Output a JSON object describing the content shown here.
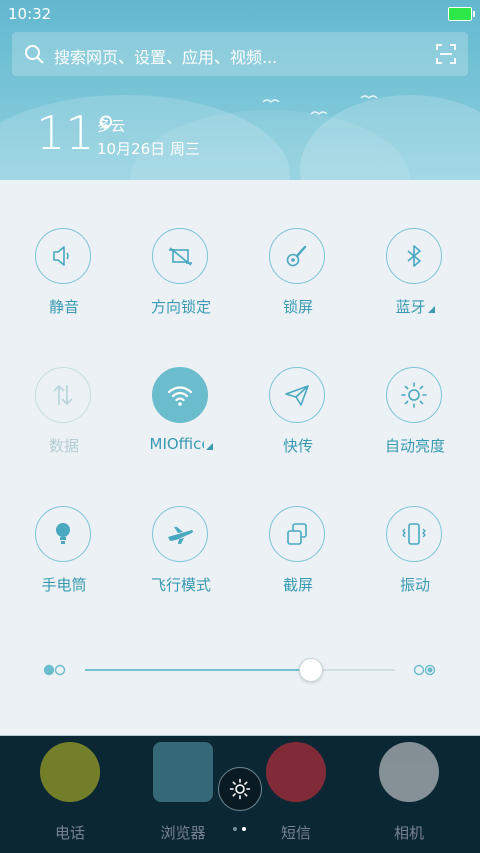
{
  "status": {
    "time": "10:32"
  },
  "search": {
    "placeholder": "搜索网页、设置、应用、视频..."
  },
  "weather": {
    "temperature": "11°",
    "condition": "多云",
    "date": "10月26日 周三"
  },
  "toggles": [
    {
      "label": "静音",
      "icon": "speaker-icon",
      "state": "off"
    },
    {
      "label": "方向锁定",
      "icon": "rotation-lock-icon",
      "state": "off"
    },
    {
      "label": "锁屏",
      "icon": "lock-screen-icon",
      "state": "off"
    },
    {
      "label": "蓝牙",
      "icon": "bluetooth-icon",
      "state": "off",
      "has_menu": true
    },
    {
      "label": "数据",
      "icon": "mobile-data-icon",
      "state": "disabled"
    },
    {
      "label": "MIOffice",
      "icon": "wifi-icon",
      "state": "on",
      "has_menu": true
    },
    {
      "label": "快传",
      "icon": "paper-plane-icon",
      "state": "off"
    },
    {
      "label": "自动亮度",
      "icon": "auto-brightness-icon",
      "state": "off"
    },
    {
      "label": "手电筒",
      "icon": "flashlight-icon",
      "state": "off"
    },
    {
      "label": "飞行模式",
      "icon": "airplane-icon",
      "state": "off"
    },
    {
      "label": "截屏",
      "icon": "screenshot-icon",
      "state": "off"
    },
    {
      "label": "振动",
      "icon": "vibrate-icon",
      "state": "off"
    }
  ],
  "brightness": {
    "level": 0.73
  },
  "dock": [
    {
      "label": "电话",
      "icon": "phone-icon",
      "color": "#c8c820"
    },
    {
      "label": "浏览器",
      "icon": "browser-icon",
      "color": "#5aa0b0"
    },
    {
      "label": "短信",
      "icon": "message-icon",
      "color": "#e0303a"
    },
    {
      "label": "相机",
      "icon": "camera-icon",
      "color": "#e8e8e8"
    }
  ],
  "colors": {
    "accent": "#3a9ab2",
    "active": "#6bbccc",
    "header": "#6cbfd3"
  }
}
